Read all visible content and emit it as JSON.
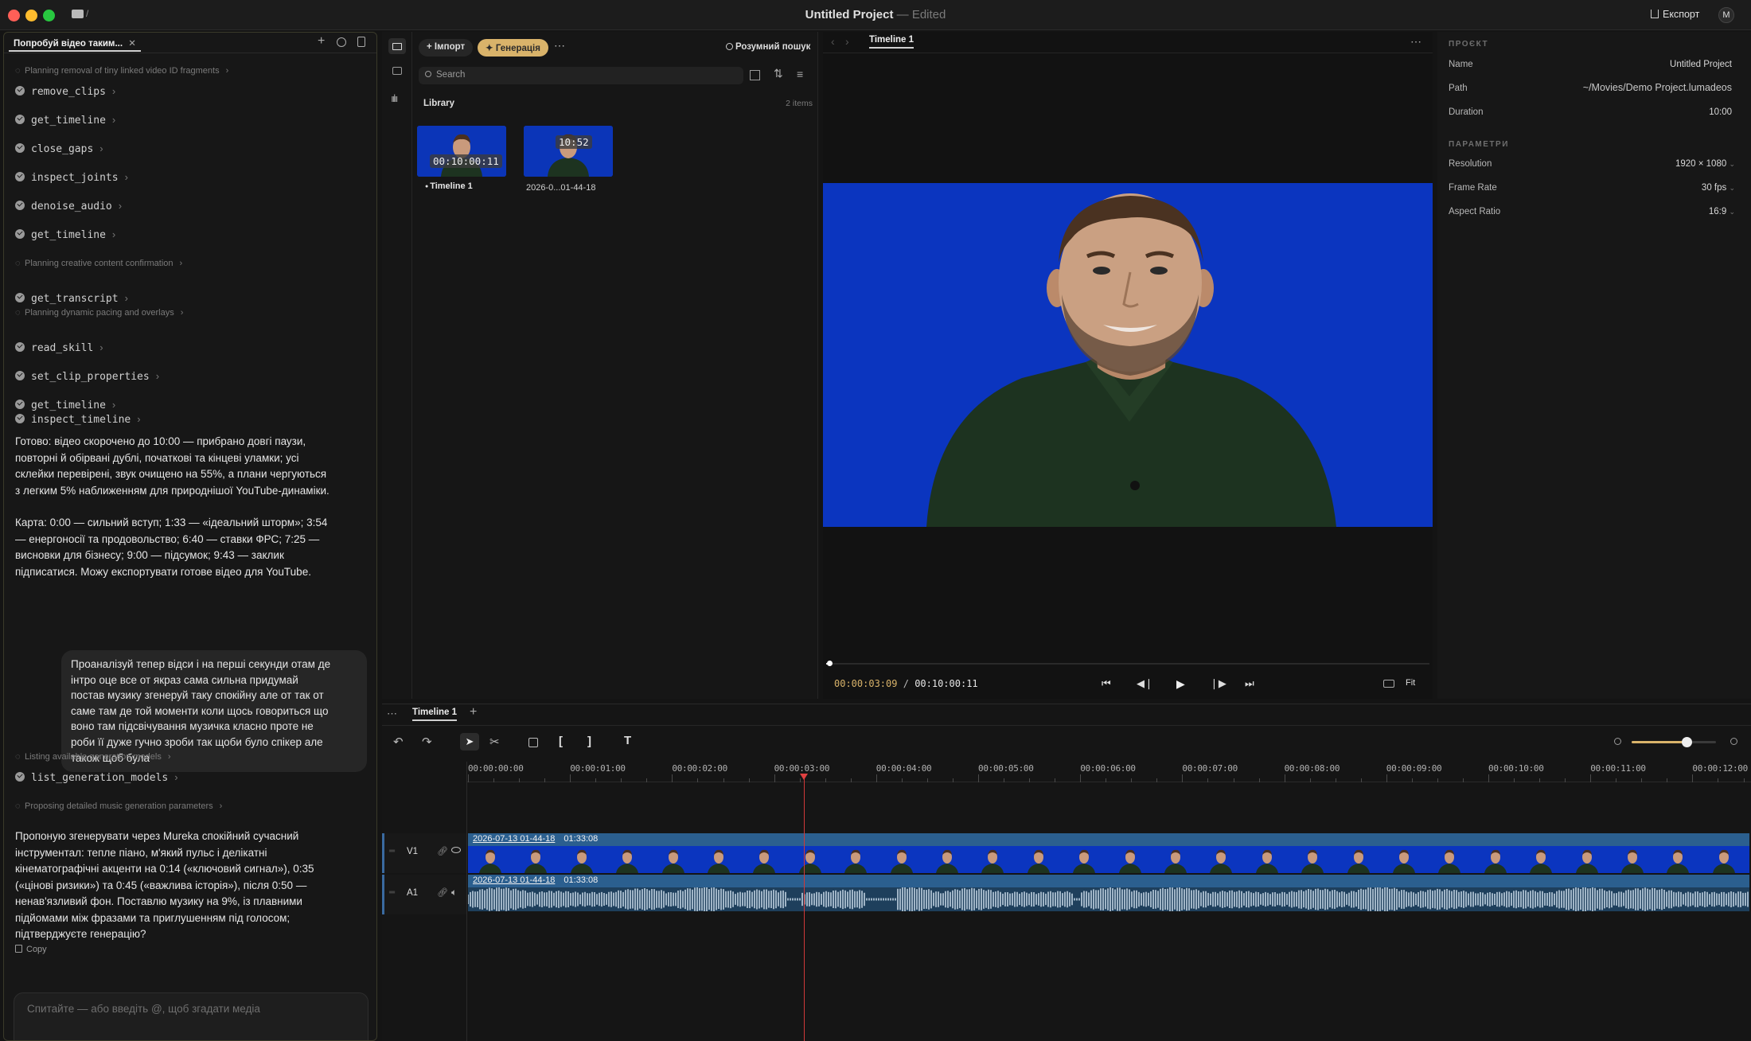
{
  "window": {
    "title": "Untitled Project",
    "status": "Edited",
    "export_label": "Експорт",
    "avatar_initial": "M"
  },
  "chat": {
    "tab_label": "Попробуй відео таким...",
    "steps": [
      {
        "kind": "plan",
        "text": "Planning removal of tiny linked video ID fragments"
      },
      {
        "kind": "tool",
        "text": "remove_clips"
      },
      {
        "kind": "tool",
        "text": "get_timeline"
      },
      {
        "kind": "tool",
        "text": "close_gaps"
      },
      {
        "kind": "tool",
        "text": "inspect_joints"
      },
      {
        "kind": "tool",
        "text": "denoise_audio"
      },
      {
        "kind": "tool",
        "text": "get_timeline"
      },
      {
        "kind": "plan",
        "text": "Planning creative content confirmation"
      },
      {
        "kind": "tool",
        "text": "get_transcript"
      },
      {
        "kind": "plan",
        "text": "Planning dynamic pacing and overlays"
      },
      {
        "kind": "tool",
        "text": "read_skill"
      },
      {
        "kind": "tool",
        "text": "set_clip_properties"
      },
      {
        "kind": "tool",
        "text": "get_timeline"
      },
      {
        "kind": "tool",
        "text": "inspect_timeline"
      }
    ],
    "assistant_msg_1_lines": [
      "Готово: відео скорочено до 10:00 — прибрано довгі паузи,",
      "повторні й обірвані дублі, початкові та кінцеві уламки; усі",
      "склейки перевірені, звук очищено на 55%, а плани чергуються",
      "з легким 5% наближенням для природнішої YouTube-динаміки."
    ],
    "assistant_msg_2_lines": [
      "Карта: 0:00 — сильний вступ; 1:33 — «ідеальний шторм»; 3:54",
      "— енергоносії та продовольство; 6:40 — ставки ФРС; 7:25 —",
      "висновки для бізнесу; 9:00 — підсумок; 9:43 — заклик",
      "підписатися. Можу експортувати готове відео для YouTube."
    ],
    "user_msg_lines": [
      "Проаналізуй тепер відси і на перші секунди отам де",
      "інтро оце все от якраз сама сильна придумай",
      "постав музику згенеруй таку спокійну але от так от",
      "саме там де той моменти коли щось говориться що",
      "воно там підсвічування музичка класно проте не",
      "роби її дуже гучно зроби так щоби було спікер але",
      "також щоб була"
    ],
    "steps_2": [
      {
        "kind": "plan",
        "text": "Listing available generation models"
      },
      {
        "kind": "tool",
        "text": "list_generation_models"
      },
      {
        "kind": "plan",
        "text": "Proposing detailed music generation parameters"
      }
    ],
    "assistant_msg_3_lines": [
      "Пропоную згенерувати через Mureka спокійний сучасний",
      "інструментал: тепле піано, м'який пульс і делікатні",
      "кінематографічні акценти на 0:14 («ключовий сигнал»), 0:35",
      "(«цінові ризики») та 0:45 («важлива історія»), після 0:50 —",
      "ненав'язливий фон. Поставлю музику на 9%, із плавними",
      "підйомами між фразами та приглушенням під голосом;",
      "підтверджуєте генерацію?"
    ],
    "copy_label": "Copy",
    "composer_placeholder": "Спитайте — або введіть @, щоб згадати медіа"
  },
  "media": {
    "import_label": "Імпорт",
    "generate_label": "Генерація",
    "smart_search_label": "Розумний пошук",
    "search_placeholder": "Search",
    "library_label": "Library",
    "items_count": "2 items",
    "items": [
      {
        "duration": "00:10:00:11",
        "name": "Timeline 1"
      },
      {
        "duration": "10:52",
        "name": "2026-0...01-44-18"
      }
    ]
  },
  "preview": {
    "tab_label": "Timeline 1",
    "current_time": "00:00:03:09",
    "separator": "/",
    "total_time": "00:10:00:11",
    "fit_label": "Fit",
    "progress_fraction": 0.005
  },
  "inspector": {
    "project_header": "ПРОЄКТ",
    "name_key": "Name",
    "name_value": "Untitled Project",
    "path_key": "Path",
    "path_value": "~/Movies/Demo Project.lumadeos",
    "duration_key": "Duration",
    "duration_value": "10:00",
    "params_header": "ПАРАМЕТРИ",
    "resolution_key": "Resolution",
    "resolution_value": "1920 × 1080",
    "framerate_key": "Frame Rate",
    "framerate_value": "30 fps",
    "aspect_key": "Aspect Ratio",
    "aspect_value": "16:9"
  },
  "timeline": {
    "tab_label": "Timeline 1",
    "ruler": [
      "00:00:00:00",
      "00:00:01:00",
      "00:00:02:00",
      "00:00:03:00",
      "00:00:04:00",
      "00:00:05:00",
      "00:00:06:00",
      "00:00:07:00",
      "00:00:08:00",
      "00:00:09:00",
      "00:00:10:00",
      "00:00:11:00",
      "00:00:12:00"
    ],
    "zoom_fraction": 0.65,
    "video_track": "V1",
    "audio_track": "A1",
    "video_clip_name": "2026-07-13 01-44-18",
    "video_clip_duration": "01:33:08",
    "audio_clip_name": "2026-07-13 01-44-18",
    "audio_clip_duration": "01:33:08"
  },
  "colors": {
    "accent_gold": "#d9b36a",
    "clip_blue": "#2b5f8f",
    "video_bg": "#0b35bf",
    "playhead": "#d03838"
  }
}
